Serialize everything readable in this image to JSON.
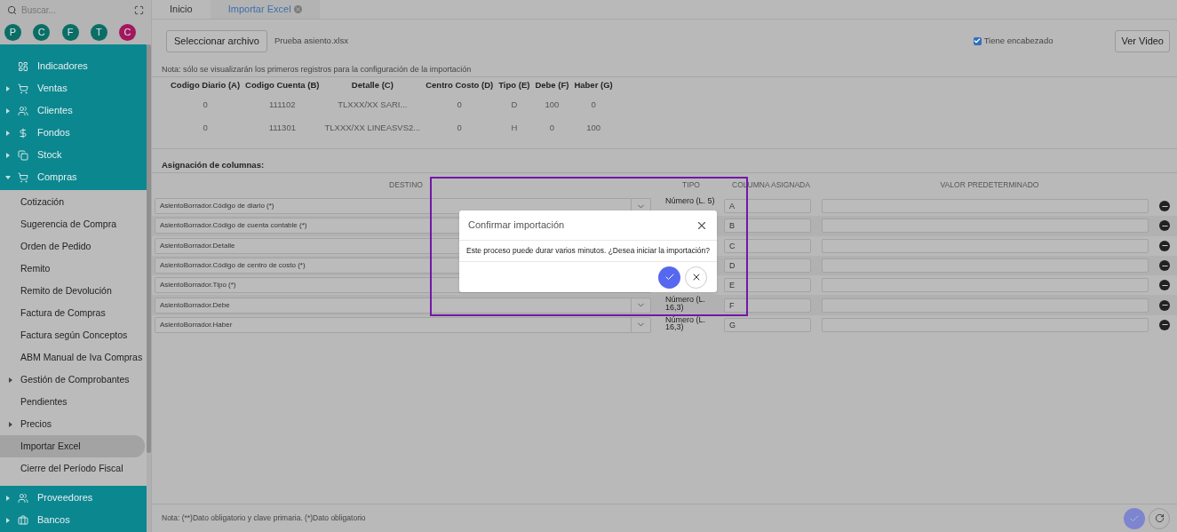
{
  "sidebar": {
    "search": {
      "placeholder": "Buscar..."
    },
    "avatars": [
      {
        "letter": "P",
        "color": "#0a6e66"
      },
      {
        "letter": "C",
        "color": "#0a6e66"
      },
      {
        "letter": "F",
        "color": "#0a6e66"
      },
      {
        "letter": "T",
        "color": "#0a6e66"
      },
      {
        "letter": "C",
        "color": "#a3175f"
      }
    ],
    "menu": [
      {
        "label": "Indicadores",
        "expandable": false
      },
      {
        "label": "Ventas",
        "expandable": true,
        "expanded": false
      },
      {
        "label": "Clientes",
        "expandable": true,
        "expanded": false
      },
      {
        "label": "Fondos",
        "expandable": true,
        "expanded": false
      },
      {
        "label": "Stock",
        "expandable": true,
        "expanded": false
      },
      {
        "label": "Compras",
        "expandable": true,
        "expanded": true,
        "children": [
          {
            "label": "Cotización",
            "expandable": false,
            "selected": false
          },
          {
            "label": "Sugerencia de Compra",
            "expandable": false,
            "selected": false
          },
          {
            "label": "Orden de Pedido",
            "expandable": false,
            "selected": false
          },
          {
            "label": "Remito",
            "expandable": false,
            "selected": false
          },
          {
            "label": "Remito de Devolución",
            "expandable": false,
            "selected": false
          },
          {
            "label": "Factura de Compras",
            "expandable": false,
            "selected": false
          },
          {
            "label": "Factura según Conceptos",
            "expandable": false,
            "selected": false
          },
          {
            "label": "ABM Manual de Iva Compras",
            "expandable": false,
            "selected": false
          },
          {
            "label": "Gestión de Comprobantes",
            "expandable": true,
            "selected": false
          },
          {
            "label": "Pendientes",
            "expandable": false,
            "selected": false
          },
          {
            "label": "Precios",
            "expandable": true,
            "selected": false
          },
          {
            "label": "Importar Excel",
            "expandable": false,
            "selected": true
          },
          {
            "label": "Cierre del Período Fiscal",
            "expandable": false,
            "selected": false
          }
        ]
      },
      {
        "label": "Proveedores",
        "expandable": true,
        "expanded": false
      },
      {
        "label": "Bancos",
        "expandable": true,
        "expanded": false
      }
    ]
  },
  "tabs": [
    {
      "label": "Inicio",
      "selected": false,
      "closable": false
    },
    {
      "label": "Importar Excel",
      "selected": true,
      "closable": true
    }
  ],
  "toolbar": {
    "select_button": "Seleccionar archivo",
    "file_name": "Prueba asiento.xlsx",
    "header_checkbox": {
      "label": "Tiene encabezado",
      "checked": true
    },
    "video_button": "Ver Video"
  },
  "note": "Nota: sólo se visualizarán los primeros registros para la configuración de la importación",
  "preview": {
    "columns": [
      "Codigo Diario (A)",
      "Codigo Cuenta (B)",
      "Detalle (C)",
      "Centro Costo (D)",
      "Tipo (E)",
      "Debe (F)",
      "Haber (G)"
    ],
    "rows": [
      [
        "0",
        "111102",
        "TLXXX/XX SARI...",
        "0",
        "D",
        "100",
        "0"
      ],
      [
        "0",
        "111301",
        "TLXXX/XX LINEASVS2...",
        "0",
        "H",
        "0",
        "100"
      ]
    ]
  },
  "mapping": {
    "title": "Asignación de columnas:",
    "columns": [
      "DESTINO",
      "TIPO",
      "COLUMNA ASIGNADA",
      "VALOR PREDETERMINADO"
    ],
    "rows": [
      {
        "destino": "AsientoBorrador.Código de diario (*)",
        "tipo": "Número (L. 5)",
        "columna": "A"
      },
      {
        "destino": "AsientoBorrador.Código de cuenta contable (*)",
        "columna": "B"
      },
      {
        "destino": "AsientoBorrador.Detalle",
        "columna": "C"
      },
      {
        "destino": "AsientoBorrador.Código de centro de costo (*)",
        "columna": "D"
      },
      {
        "destino": "AsientoBorrador.Tipo (*)",
        "columna": "E"
      },
      {
        "destino": "AsientoBorrador.Debe",
        "tipo": "Número (L. 16,3)",
        "columna": "F"
      },
      {
        "destino": "AsientoBorrador.Haber",
        "tipo": "Número (L. 16,3)",
        "columna": "G"
      }
    ]
  },
  "footer_note": "Nota: (**)Dato obligatorio y clave primaria. (*)Dato obligatorio",
  "dialog": {
    "title": "Confirmar importación",
    "message": "Este proceso puede durar varios minutos. ¿Desea iniciar la importación?"
  }
}
